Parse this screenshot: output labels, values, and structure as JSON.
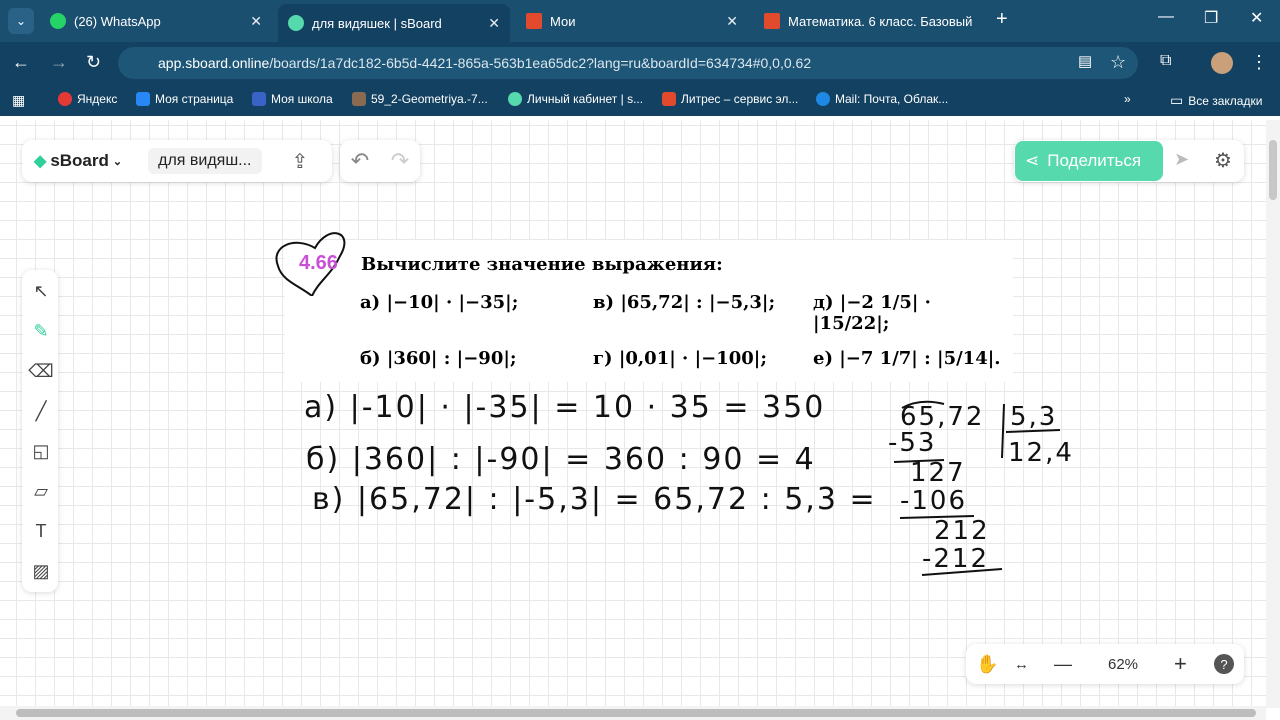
{
  "browser": {
    "tabs": [
      {
        "label": "(26) WhatsApp"
      },
      {
        "label": "для видяшек | sBoard"
      },
      {
        "label": "Мои"
      },
      {
        "label": "Математика. 6 класс. Базовый"
      }
    ],
    "url_host": "app.sboard.online",
    "url_path": "/boards/1a7dc182-6b5d-4421-865a-563b1ea65dc2?lang=ru&boardId=634734#0,0,0.62",
    "bookmarks": [
      "Яндекс",
      "Моя страница",
      "Моя школа",
      "59_2-Geometriya.-7...",
      "Личный кабинет | s...",
      "Литрес – сервис эл...",
      "Mail: Почта, Облак..."
    ],
    "all_bookmarks": "Все закладки"
  },
  "app": {
    "logo": "sBoard",
    "board_name": "для видяш...",
    "share_label": "Поделиться",
    "zoom": "62%"
  },
  "task": {
    "number": "4.66",
    "title": "Вычислите значение выражения:",
    "items": [
      {
        "label": "а)",
        "expr": "|−10| · |−35|;"
      },
      {
        "label": "в)",
        "expr": "|65,72| : |−5,3|;"
      },
      {
        "label": "д)",
        "expr": "|−2 1/5| · |15/22|;"
      },
      {
        "label": "б)",
        "expr": "|360| : |−90|;"
      },
      {
        "label": "г)",
        "expr": "|0,01| · |−100|;"
      },
      {
        "label": "е)",
        "expr": "|−7 1/7| : |5/14|."
      }
    ]
  },
  "handwriting": {
    "line_a": "а)   |-10| · |-35| = 10 · 35 = 350",
    "line_b": "б)   |360| : |-90| = 360 : 90 = 4",
    "line_v": "в)   |65,72| : |-5,3| = 65,72 : 5,3 =",
    "division": {
      "dividend": "65,72",
      "divisor": "5,3",
      "quotient": "12,4",
      "steps": [
        "-53",
        "127",
        "-106",
        "212",
        "-212"
      ]
    }
  },
  "colors": {
    "tabbar": "#1b4f70",
    "accent": "#56d9ad",
    "task_number": "#c84fd6"
  }
}
